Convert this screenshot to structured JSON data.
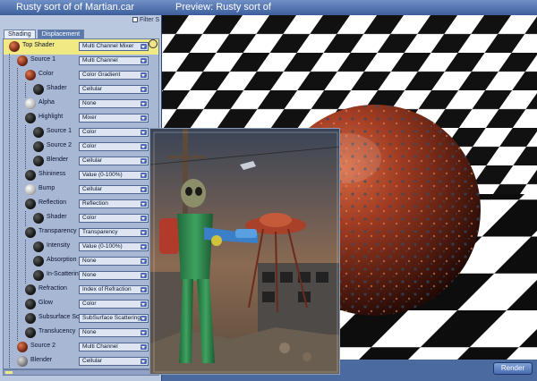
{
  "editor": {
    "title": "Rusty sort of of Martian.car",
    "filter_label": "Filter S",
    "tabs": [
      {
        "label": "Shading"
      },
      {
        "label": "Displacement"
      }
    ],
    "rows": [
      {
        "label": "Top Shader",
        "value": "Multi Channel Mixer",
        "ball": "rust"
      },
      {
        "label": "Source 1",
        "value": "Multi Channel",
        "ball": "rust"
      },
      {
        "label": "Color",
        "value": "Color Gradient",
        "ball": "rust"
      },
      {
        "label": "Shader",
        "value": "Cellular",
        "ball": "dark"
      },
      {
        "label": "Alpha",
        "value": "None",
        "ball": "white"
      },
      {
        "label": "Highlight",
        "value": "Mixer",
        "ball": "dark"
      },
      {
        "label": "Source 1",
        "value": "Color",
        "ball": "dark"
      },
      {
        "label": "Source 2",
        "value": "Color",
        "ball": "dark"
      },
      {
        "label": "Blender",
        "value": "Cellular",
        "ball": "dark"
      },
      {
        "label": "Shininess",
        "value": "Value (0-100%)",
        "ball": "dark"
      },
      {
        "label": "Bump",
        "value": "Cellular",
        "ball": "white"
      },
      {
        "label": "Reflection",
        "value": "Reflection",
        "ball": "dark"
      },
      {
        "label": "Shader",
        "value": "Color",
        "ball": "dark"
      },
      {
        "label": "Transparency",
        "value": "Transparency",
        "ball": "dark"
      },
      {
        "label": "Intensity",
        "value": "Value (0-100%)",
        "ball": "dark"
      },
      {
        "label": "Absorption",
        "value": "None",
        "ball": "dark"
      },
      {
        "label": "In-Scattering",
        "value": "None",
        "ball": "dark"
      },
      {
        "label": "Refraction",
        "value": "Index of Refraction",
        "ball": "dark"
      },
      {
        "label": "Glow",
        "value": "Color",
        "ball": "dark"
      },
      {
        "label": "Subsurface Sc",
        "value": "SubSurface Scattering",
        "ball": "dark"
      },
      {
        "label": "Translucency",
        "value": "None",
        "ball": "dark"
      },
      {
        "label": "Source 2",
        "value": "Multi Channel",
        "ball": "rust"
      },
      {
        "label": "Blender",
        "value": "Cellular",
        "ball": "gray"
      }
    ]
  },
  "preview": {
    "title": "Preview: Rusty sort of",
    "render_label": "Render"
  },
  "colors": {
    "selection": "#f1ea84",
    "title_bar": "#3c5f9c",
    "panel": "#b9c7df"
  }
}
